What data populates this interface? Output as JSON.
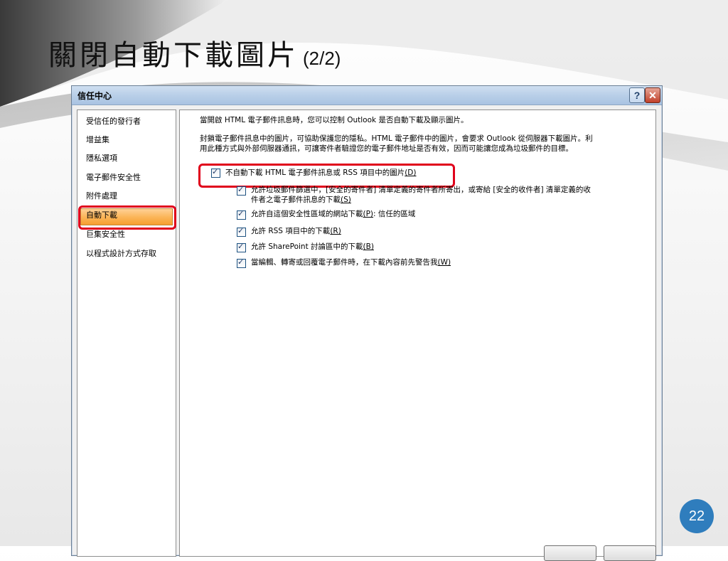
{
  "slide": {
    "title": "關閉自動下載圖片",
    "title_suffix": "(2/2)",
    "page_number": "22"
  },
  "dialog": {
    "title": "信任中心",
    "help_label": "?",
    "close_label": "✕"
  },
  "nav": {
    "items": [
      {
        "label": "受信任的發行者"
      },
      {
        "label": "增益集"
      },
      {
        "label": "隱私選項"
      },
      {
        "label": "電子郵件安全性"
      },
      {
        "label": "附件處理"
      },
      {
        "label": "自動下載"
      },
      {
        "label": "巨集安全性"
      },
      {
        "label": "以程式設計方式存取"
      }
    ],
    "selected_index": 5
  },
  "content": {
    "intro": "當開啟 HTML 電子郵件訊息時，您可以控制 Outlook 是否自動下載及顯示圖片。",
    "desc_line1": "封鎖電子郵件訊息中的圖片，可協助保護您的隱私。HTML 電子郵件中的圖片，會要求 Outlook 從伺服器下載圖片。利",
    "desc_line2": "用此種方式與外部伺服器通訊，可讓寄件者驗證您的電子郵件地址是否有效，因而可能讓您成為垃圾郵件的目標。",
    "main_option": {
      "label": "不自動下載 HTML 電子郵件訊息或 RSS 項目中的圖片",
      "mnemonic": "(D)",
      "checked": true
    },
    "sub_options": [
      {
        "label_line1": "允許垃圾郵件篩選中，[安全的寄件者] 清單定義的寄件者所寄出，或寄給 [安全的收件者] 清單定義的收",
        "label_line2": "件者之電子郵件訊息的下載",
        "mnemonic": "(S)",
        "checked": true
      },
      {
        "label": "允許自這個安全性區域的網站下載",
        "mnemonic": "(P)",
        "suffix": ": 信任的區域",
        "checked": true
      },
      {
        "label": "允許 RSS 項目中的下載",
        "mnemonic": "(R)",
        "checked": true
      },
      {
        "label": "允許 SharePoint 討論區中的下載",
        "mnemonic": "(B)",
        "checked": true
      },
      {
        "label": "當編輯、轉寄或回覆電子郵件時，在下載內容前先警告我",
        "mnemonic": "(W)",
        "checked": true
      }
    ]
  },
  "colors": {
    "accent_red": "#e0001b",
    "nav_selected": "#f69f2f",
    "page_badge": "#2f7dbd"
  }
}
